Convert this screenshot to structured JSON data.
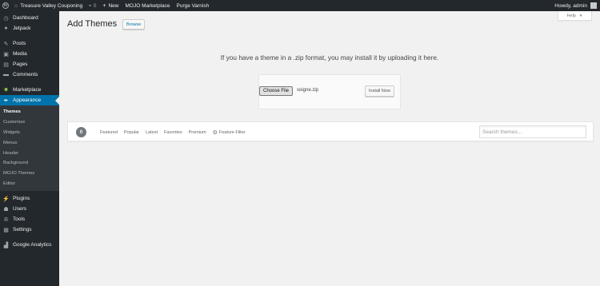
{
  "adminbar": {
    "site_name": "Treasure Valley Couponing",
    "comments_count": "0",
    "new_label": "New",
    "marketplace_label": "MOJO Marketplace",
    "purge_label": "Purge Varnish",
    "howdy": "Howdy, admin"
  },
  "sidebar": {
    "dashboard": "Dashboard",
    "jetpack": "Jetpack",
    "posts": "Posts",
    "media": "Media",
    "pages": "Pages",
    "comments": "Comments",
    "marketplace": "Marketplace",
    "appearance": "Appearance",
    "submenu": [
      "Themes",
      "Customize",
      "Widgets",
      "Menus",
      "Header",
      "Background",
      "MOJO Themes",
      "Editor"
    ],
    "plugins": "Plugins",
    "users": "Users",
    "tools": "Tools",
    "settings": "Settings",
    "analytics": "Google Analytics"
  },
  "main": {
    "title": "Add Themes",
    "browse_label": "Browse",
    "help_label": "Help",
    "upload_desc": "If you have a theme in a .zip format, you may install it by uploading it here.",
    "choose_file_label": "Choose File",
    "file_name": "soigne.zip",
    "install_label": "Install Now",
    "theme_count": "0",
    "filters": [
      "Featured",
      "Popular",
      "Latest",
      "Favorites",
      "Premium"
    ],
    "feature_filter_label": "Feature Filter",
    "search_placeholder": "Search themes..."
  },
  "colors": {
    "admin_dark": "#23282d",
    "submenu_bg": "#32373c",
    "accent": "#0073aa",
    "page_bg": "#f1f1f1"
  }
}
